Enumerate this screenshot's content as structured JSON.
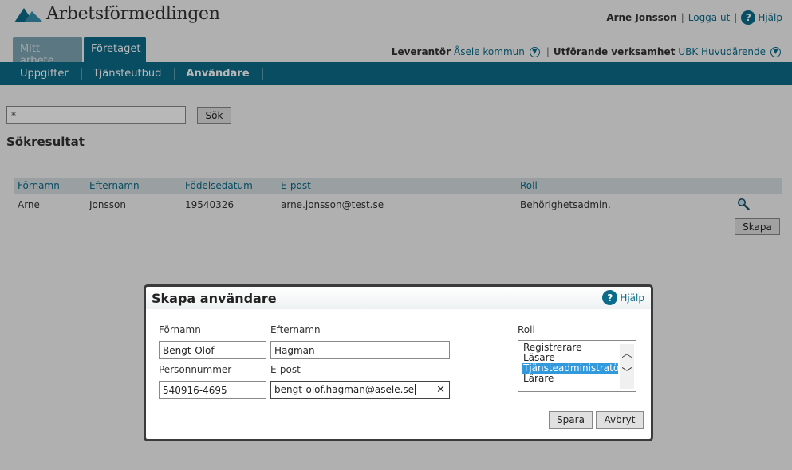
{
  "header": {
    "logo_text": "Arbetsförmedlingen",
    "user_name": "Arne Jonsson",
    "separator": "|",
    "logout": "Logga ut",
    "help": "Hjälp",
    "tabs": [
      {
        "label": "Mitt arbete"
      },
      {
        "label": "Företaget"
      }
    ],
    "supplier_label": "Leverantör",
    "supplier_value": "Åsele kommun",
    "unit_label": "Utförande verksamhet",
    "unit_value": "UBK Huvudärende"
  },
  "nav": {
    "items": [
      {
        "label": "Uppgifter"
      },
      {
        "label": "Tjänsteutbud"
      },
      {
        "label": "Användare"
      }
    ]
  },
  "search": {
    "value": "*",
    "button": "Sök"
  },
  "results": {
    "heading": "Sökresultat",
    "columns": [
      "Förnamn",
      "Efternamn",
      "Födelsedatum",
      "E-post",
      "Roll"
    ],
    "rows": [
      {
        "first": "Arne",
        "last": "Jonsson",
        "birth": "19540326",
        "email": "arne.jonsson@test.se",
        "role": "Behörighetsadmin."
      }
    ],
    "create_button": "Skapa"
  },
  "dialog": {
    "title": "Skapa användare",
    "help": "Hjälp",
    "first_name_label": "Förnamn",
    "first_name_value": "Bengt-Olof",
    "last_name_label": "Efternamn",
    "last_name_value": "Hagman",
    "pnr_label": "Personnummer",
    "pnr_value": "540916-4695",
    "email_label": "E-post",
    "email_value": "bengt-olof.hagman@asele.se",
    "role_label": "Roll",
    "roles": [
      "Registrerare",
      "Läsare",
      "Tjänsteadministratör",
      "Lärare"
    ],
    "selected_role": "Tjänsteadministratör",
    "save": "Spara",
    "cancel": "Avbryt"
  },
  "colors": {
    "brand": "#0d6b8a",
    "link": "#0a6b8a",
    "selection": "#3399dd"
  }
}
